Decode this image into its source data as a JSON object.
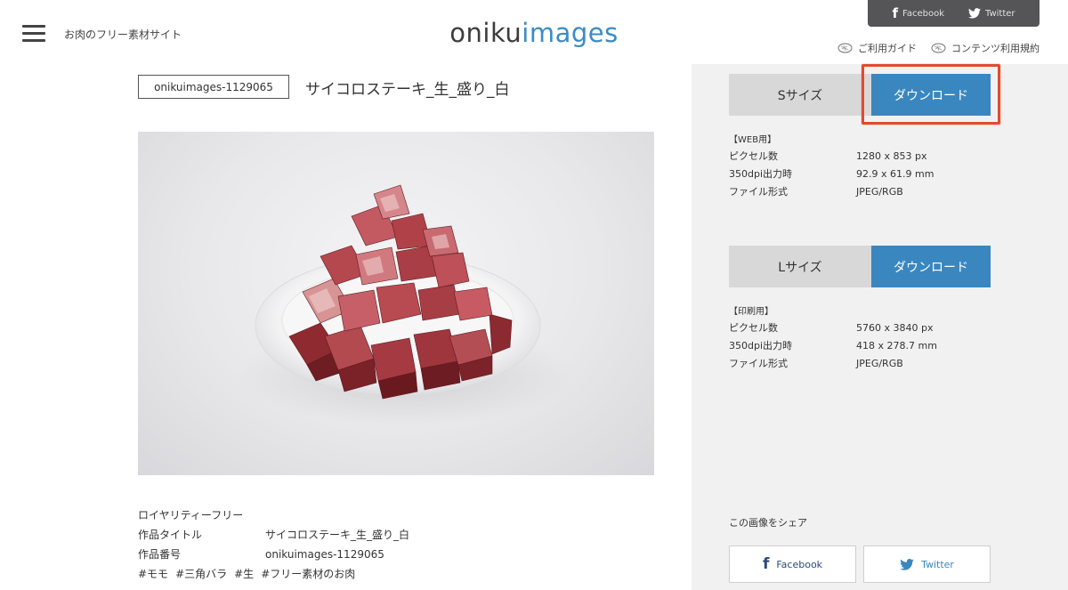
{
  "header": {
    "tagline": "お肉のフリー素材サイト",
    "logo_part1": "oniku",
    "logo_part2": "images",
    "social": {
      "facebook": "Facebook",
      "twitter": "Twitter"
    },
    "links": [
      "ご利用ガイド",
      "コンテンツ利用規約"
    ]
  },
  "image": {
    "id": "onikuimages-1129065",
    "title": "サイコロステーキ_生_盛り_白"
  },
  "info": {
    "license": "ロイヤリティーフリー",
    "title_label": "作品タイトル",
    "title_value": "サイコロステーキ_生_盛り_白",
    "number_label": "作品番号",
    "number_value": "onikuimages-1129065",
    "tags": [
      "#モモ",
      "#三角バラ",
      "#生",
      "#フリー素材のお肉"
    ]
  },
  "sizes": [
    {
      "label": "Sサイズ",
      "button": "ダウンロード",
      "usage": "【WEB用】",
      "specs": [
        {
          "key": "ピクセル数",
          "value": "1280 x 853 px"
        },
        {
          "key": "350dpi出力時",
          "value": "92.9 x 61.9 mm"
        },
        {
          "key": "ファイル形式",
          "value": "JPEG/RGB"
        }
      ]
    },
    {
      "label": "Lサイズ",
      "button": "ダウンロード",
      "usage": "【印刷用】",
      "specs": [
        {
          "key": "ピクセル数",
          "value": "5760 x 3840 px"
        },
        {
          "key": "350dpi出力時",
          "value": "418 x 278.7 mm"
        },
        {
          "key": "ファイル形式",
          "value": "JPEG/RGB"
        }
      ]
    }
  ],
  "share": {
    "label": "この画像をシェア",
    "facebook": "Facebook",
    "twitter": "Twitter"
  },
  "colors": {
    "accent_blue": "#3a87c0",
    "highlight_red": "#e24a2f",
    "sidebar_bg": "#f1f1f1"
  }
}
